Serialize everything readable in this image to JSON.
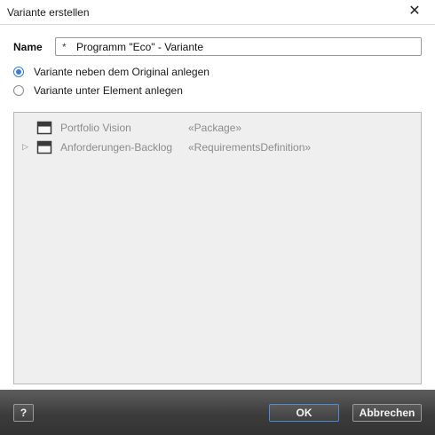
{
  "window": {
    "title": "Variante erstellen",
    "close_glyph": "✕"
  },
  "name_field": {
    "label": "Name",
    "prefix_glyph": "*",
    "value": "Programm \"Eco\" - Variante"
  },
  "options": [
    {
      "label": "Variante neben dem Original anlegen",
      "checked": true
    },
    {
      "label": "Variante unter Element anlegen",
      "checked": false
    }
  ],
  "tree": {
    "items": [
      {
        "name": "Portfolio Vision",
        "stereotype": "«Package»",
        "expandable": false,
        "icon": "package-icon"
      },
      {
        "name": "Anforderungen-Backlog",
        "stereotype": "«RequirementsDefinition»",
        "expandable": true,
        "expander_glyph": "▷",
        "icon": "package-icon"
      }
    ]
  },
  "footer": {
    "help_label": "?",
    "ok_label": "OK",
    "cancel_label": "Abbrechen"
  },
  "colors": {
    "accent": "#3a7bd5",
    "footer_bg": "#3c3c3c",
    "tree_bg": "#efefef",
    "disabled_text": "#8c8c8c"
  }
}
